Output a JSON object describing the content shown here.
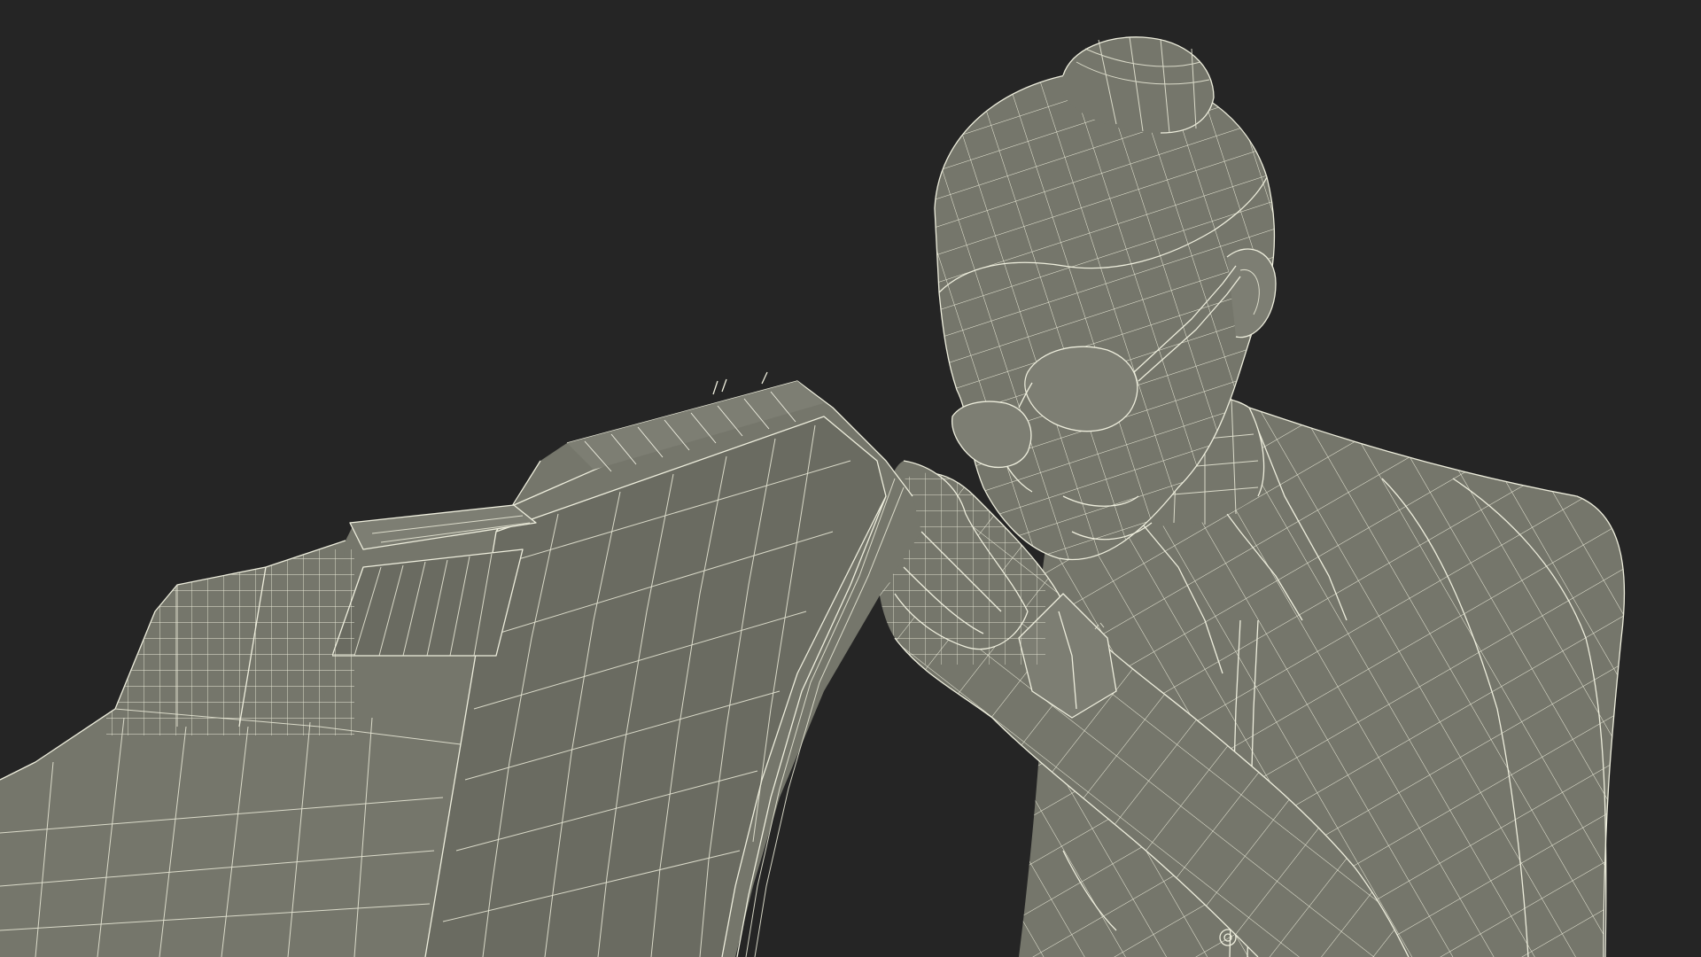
{
  "scene": {
    "render_style": "wireframe-on-shaded",
    "background_color": "#252525",
    "surface_color": "#75766b",
    "wire_color": "#eeeedd",
    "subjects": [
      "woman-figure",
      "cash-register"
    ]
  }
}
